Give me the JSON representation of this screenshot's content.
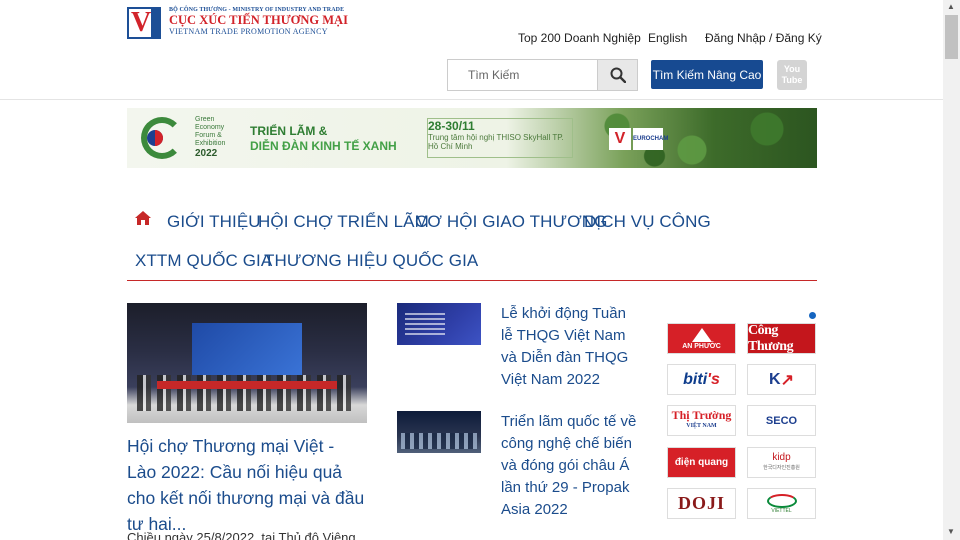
{
  "header": {
    "logo": {
      "line1": "BỘ CÔNG THƯƠNG - MINISTRY OF INDUSTRY AND TRADE",
      "line2": "CỤC XÚC TIẾN THƯƠNG MẠI",
      "line3": "VIETNAM TRADE PROMOTION AGENCY"
    },
    "top_links": [
      "Top 200 Doanh Nghiệp",
      "English",
      "Đăng Nhập / Đăng Ký"
    ],
    "search": {
      "placeholder": "Tìm Kiếm",
      "value": ""
    },
    "advanced_search_label": "Tìm Kiếm Nâng Cao",
    "youtube_label_1": "You",
    "youtube_label_2": "Tube"
  },
  "banner": {
    "small_text": "Green Economy Forum & Exhibition",
    "year": "2022",
    "title_line1": "TRIỂN LÃM &",
    "title_line2": "DIỄN ĐÀN KINH TẾ XANH",
    "date": "28-30/11",
    "venue": "Trung tâm hội nghị THISO SkyHall TP. Hồ Chí Minh",
    "partner_logo_2": "EUROCHAM"
  },
  "nav": {
    "items": [
      "GIỚI THIỆU",
      "HỘI CHỢ TRIỂN LÃM",
      "CƠ HỘI GIAO THƯƠNG",
      "DỊCH VỤ CÔNG",
      "XTTM QUỐC GIA",
      "THƯƠNG HIỆU QUỐC GIA"
    ]
  },
  "featured": {
    "title": "Hội chợ Thương mại Việt - Lào 2022: Cầu nối hiệu quả cho kết nối thương mại và đầu tư hai...",
    "description": "Chiều ngày 25/8/2022, tại Thủ đô Viêng"
  },
  "news": [
    {
      "title": "Lễ khởi động Tuần lễ THQG Việt Nam và Diễn đàn THQG Việt Nam 2022"
    },
    {
      "title": "Triển lãm quốc tế về công nghệ chế biến và đóng gói châu Á lần thứ 29 - Propak Asia 2022"
    }
  ],
  "partners": {
    "anphuoc": "AN PHƯỚC",
    "congthuong": "Công Thương",
    "bitis_1": "biti",
    "bitis_2": "'s",
    "kfa_1": "K",
    "kfa_2": "↗",
    "ttvn": "Thị Trường",
    "ttvn_sub": "VIỆT NAM",
    "seco": "SECO",
    "dienquang": "điện quang",
    "kidp": "kidp",
    "kidp_sub": "한국디자인진흥원",
    "doji": "DOJI",
    "viettel": "VIETTEL"
  },
  "colors": {
    "brand_blue": "#1b4c8c",
    "button_blue": "#174a91",
    "nav_underline": "#c62828",
    "logo_red": "#d2232a"
  }
}
